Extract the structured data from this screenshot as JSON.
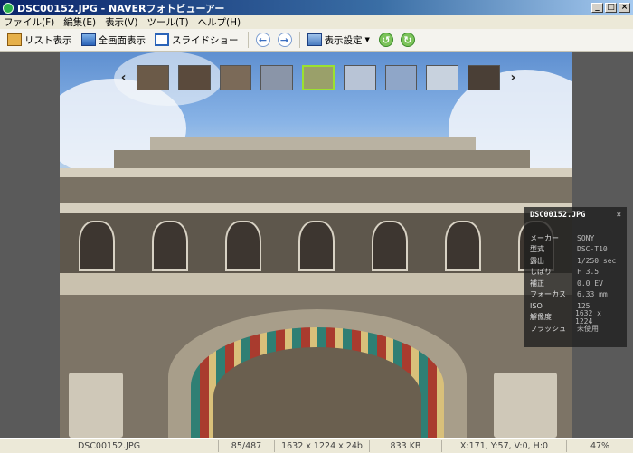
{
  "window": {
    "title": "DSC00152.JPG - NAVERフォトビューアー"
  },
  "menu": {
    "items": [
      "ファイル(F)",
      "編集(E)",
      "表示(V)",
      "ツール(T)",
      "ヘルプ(H)"
    ]
  },
  "toolbar": {
    "list_view": "リスト表示",
    "fullscreen": "全画面表示",
    "slideshow": "スライドショー",
    "view_settings": "表示設定"
  },
  "info_panel": {
    "title": "DSC00152.JPG",
    "rows": [
      {
        "key": "メーカー",
        "value": "SONY"
      },
      {
        "key": "型式",
        "value": "DSC-T10"
      },
      {
        "key": "露出",
        "value": "1/250 sec"
      },
      {
        "key": "しぼり",
        "value": "F 3.5"
      },
      {
        "key": "補正",
        "value": "0.0 EV"
      },
      {
        "key": "フォーカス",
        "value": "6.33 mm"
      },
      {
        "key": "ISO",
        "value": "125"
      },
      {
        "key": "解像度",
        "value": "1632 x 1224"
      },
      {
        "key": "フラッシュ",
        "value": "未使用"
      }
    ]
  },
  "thumbnails": {
    "count": 9,
    "selected_index": 4,
    "colors": [
      "#6b5a48",
      "#5a4a3c",
      "#7b6a58",
      "#8a95a8",
      "#9aa06a",
      "#b8c4d6",
      "#8fa6c8",
      "#c8d2de",
      "#4a3f36"
    ]
  },
  "status": {
    "filename": "DSC00152.JPG",
    "position": "85/487",
    "dimensions": "1632 x 1224 x 24b",
    "filesize": "833 KB",
    "coords": "X:171, Y:57, V:0, H:0",
    "zoom": "47%"
  }
}
